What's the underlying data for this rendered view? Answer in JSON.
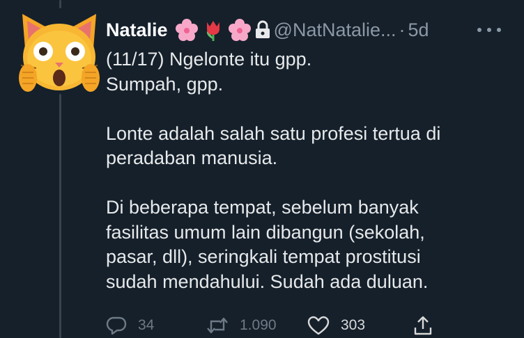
{
  "tweet": {
    "author": {
      "display_name": "Natalie",
      "name_emojis": [
        "cherry-blossom",
        "tulip",
        "cherry-blossom"
      ],
      "protected_icon": "lock-icon",
      "handle": "@NatNatalie...",
      "avatar_icon": "scream-cat-emoji"
    },
    "separator": "·",
    "time": "5d",
    "body_lines": [
      "(11/17) Ngelonte itu gpp.",
      "Sumpah, gpp.",
      "",
      "Lonte adalah salah satu profesi tertua di",
      "peradaban manusia.",
      "",
      "Di beberapa tempat, sebelum banyak",
      "fasilitas umum lain dibangun (sekolah,",
      "pasar, dll), seringkali tempat prostitusi",
      "sudah mendahului. Sudah ada duluan."
    ],
    "actions": {
      "reply": {
        "icon": "reply-icon",
        "count": "34"
      },
      "retweet": {
        "icon": "retweet-icon",
        "count": "1.090"
      },
      "like": {
        "icon": "heart-icon",
        "count": "303"
      },
      "share": {
        "icon": "share-icon"
      }
    },
    "more_icon": "more-options-icon"
  },
  "colors": {
    "background": "#15202b",
    "primary_text": "#e7e9ea",
    "secondary_text": "#8b98a5",
    "thread_line": "#38444d"
  }
}
